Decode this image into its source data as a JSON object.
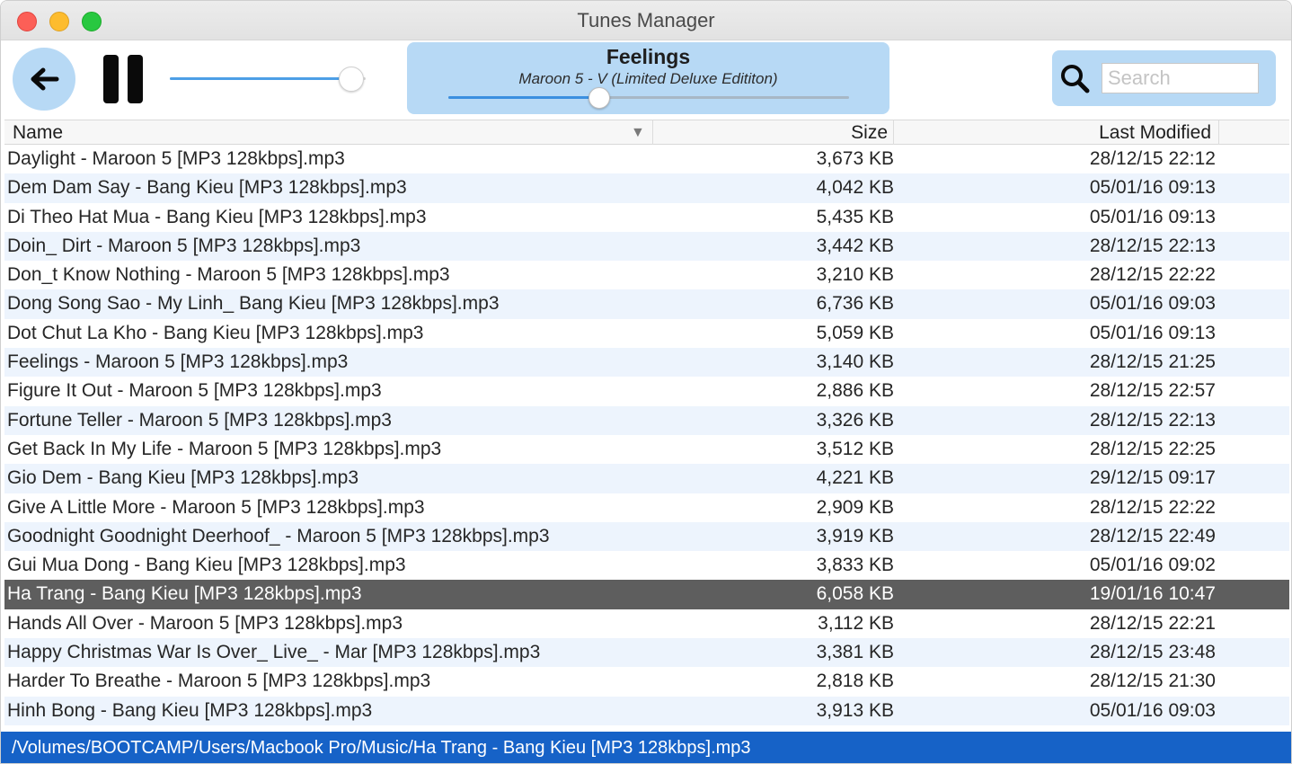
{
  "window": {
    "title": "Tunes Manager"
  },
  "player": {
    "volume_level": 0.92,
    "now_playing": {
      "title": "Feelings",
      "artist_album": "Maroon 5 - V (Limited Deluxe Edititon)",
      "progress": 0.37
    },
    "search": {
      "placeholder": "Search",
      "value": ""
    }
  },
  "table": {
    "columns": {
      "name": "Name",
      "size": "Size",
      "last_modified": "Last Modified"
    },
    "rows": [
      {
        "name": "Daylight - Maroon 5 [MP3 128kbps].mp3",
        "size": "3,673 KB",
        "modified": "28/12/15 22:12"
      },
      {
        "name": "Dem Dam Say - Bang Kieu [MP3 128kbps].mp3",
        "size": "4,042 KB",
        "modified": "05/01/16 09:13"
      },
      {
        "name": "Di Theo Hat Mua - Bang Kieu [MP3 128kbps].mp3",
        "size": "5,435 KB",
        "modified": "05/01/16 09:13"
      },
      {
        "name": "Doin_ Dirt - Maroon 5 [MP3 128kbps].mp3",
        "size": "3,442 KB",
        "modified": "28/12/15 22:13"
      },
      {
        "name": "Don_t Know Nothing - Maroon 5 [MP3 128kbps].mp3",
        "size": "3,210 KB",
        "modified": "28/12/15 22:22"
      },
      {
        "name": "Dong Song Sao - My Linh_ Bang Kieu [MP3 128kbps].mp3",
        "size": "6,736 KB",
        "modified": "05/01/16 09:03"
      },
      {
        "name": "Dot Chut La Kho - Bang Kieu [MP3 128kbps].mp3",
        "size": "5,059 KB",
        "modified": "05/01/16 09:13"
      },
      {
        "name": "Feelings - Maroon 5 [MP3 128kbps].mp3",
        "size": "3,140 KB",
        "modified": "28/12/15 21:25"
      },
      {
        "name": "Figure It Out - Maroon 5 [MP3 128kbps].mp3",
        "size": "2,886 KB",
        "modified": "28/12/15 22:57"
      },
      {
        "name": "Fortune Teller - Maroon 5 [MP3 128kbps].mp3",
        "size": "3,326 KB",
        "modified": "28/12/15 22:13"
      },
      {
        "name": "Get Back In My Life - Maroon 5 [MP3 128kbps].mp3",
        "size": "3,512 KB",
        "modified": "28/12/15 22:25"
      },
      {
        "name": "Gio Dem - Bang Kieu [MP3 128kbps].mp3",
        "size": "4,221 KB",
        "modified": "29/12/15 09:17"
      },
      {
        "name": "Give A Little More - Maroon 5 [MP3 128kbps].mp3",
        "size": "2,909 KB",
        "modified": "28/12/15 22:22"
      },
      {
        "name": "Goodnight Goodnight Deerhoof_ - Maroon 5 [MP3 128kbps].mp3",
        "size": "3,919 KB",
        "modified": "28/12/15 22:49"
      },
      {
        "name": "Gui Mua Dong - Bang Kieu [MP3 128kbps].mp3",
        "size": "3,833 KB",
        "modified": "05/01/16 09:02"
      },
      {
        "name": "Ha Trang - Bang Kieu [MP3 128kbps].mp3",
        "size": "6,058 KB",
        "modified": "19/01/16 10:47"
      },
      {
        "name": "Hands All Over - Maroon 5 [MP3 128kbps].mp3",
        "size": "3,112 KB",
        "modified": "28/12/15 22:21"
      },
      {
        "name": "Happy Christmas War Is Over_ Live_ - Mar [MP3 128kbps].mp3",
        "size": "3,381 KB",
        "modified": "28/12/15 23:48"
      },
      {
        "name": "Harder To Breathe - Maroon 5 [MP3 128kbps].mp3",
        "size": "2,818 KB",
        "modified": "28/12/15 21:30"
      },
      {
        "name": "Hinh Bong - Bang Kieu [MP3 128kbps].mp3",
        "size": "3,913 KB",
        "modified": "05/01/16 09:03"
      }
    ],
    "selected_index": 15
  },
  "status_bar": {
    "path": "/Volumes/BOOTCAMP/Users/Macbook Pro/Music/Ha Trang - Bang Kieu [MP3 128kbps].mp3"
  },
  "icons": {
    "back": "arrow-left-icon",
    "pause": "pause-icon",
    "search": "magnifier-icon",
    "sort": "sort-descending-icon"
  },
  "colors": {
    "accent_panel": "#b7d9f5",
    "selection": "#5e5e5e",
    "status_bar": "#1662c7",
    "alt_row": "#edf4fd"
  }
}
